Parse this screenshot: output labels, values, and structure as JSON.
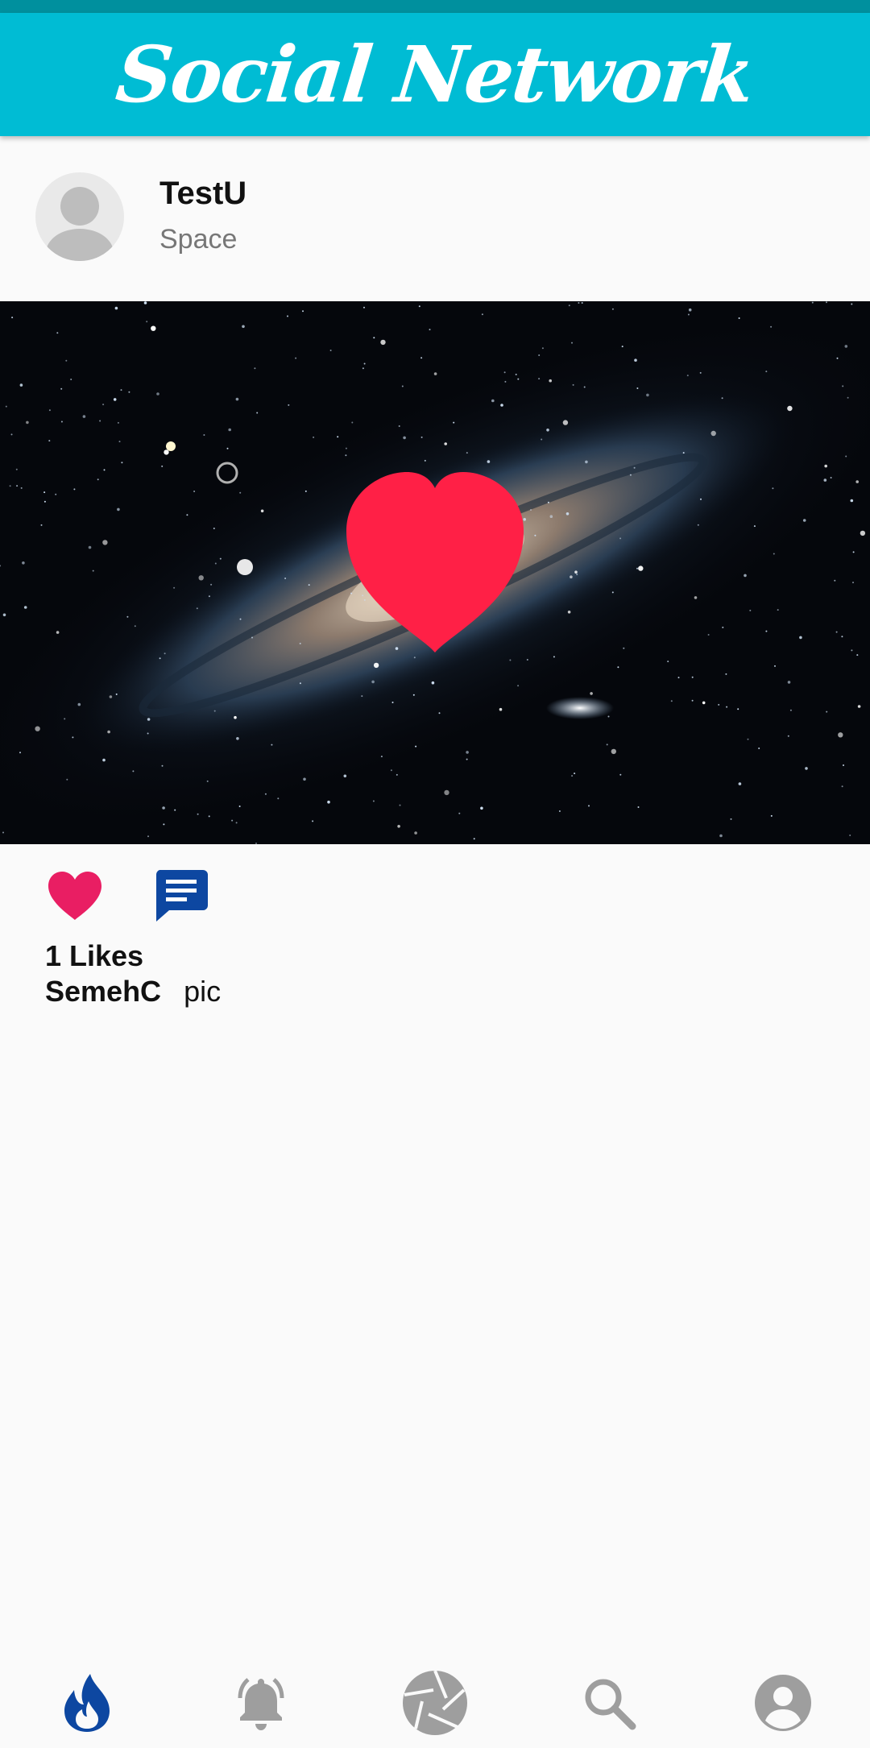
{
  "app": {
    "title": "Social Network",
    "accent_color": "#00bcd4",
    "status_bar_color": "#00909e"
  },
  "post": {
    "user_name": "TestU",
    "location": "Space",
    "avatar_icon": "default-person-avatar",
    "image_subject": "galaxy",
    "liked": true,
    "like_color": "#e91e63",
    "comment_color": "#0d47a1",
    "likes_text": "1 Likes",
    "caption_user": "SemehC",
    "caption_text": "pic"
  },
  "bottom_nav": {
    "items": [
      {
        "icon": "flame-icon",
        "active": true
      },
      {
        "icon": "bell-icon",
        "active": false
      },
      {
        "icon": "camera-shutter-icon",
        "active": false
      },
      {
        "icon": "search-icon",
        "active": false
      },
      {
        "icon": "account-icon",
        "active": false
      }
    ],
    "active_color": "#0d47a1",
    "inactive_color": "#9e9e9e"
  }
}
